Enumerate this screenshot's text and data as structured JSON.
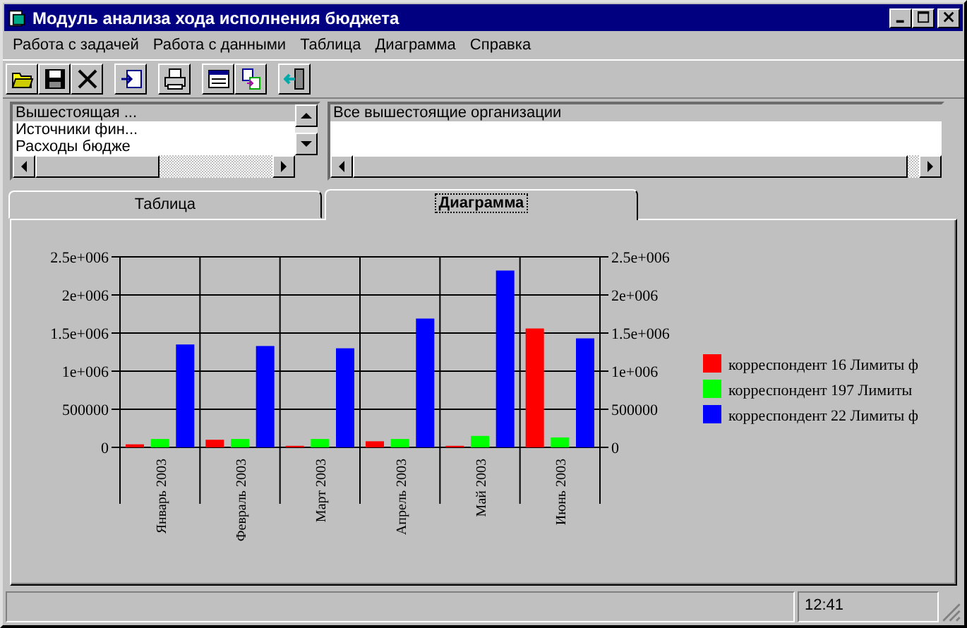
{
  "window": {
    "title": "Модуль анализа хода исполнения бюджета"
  },
  "menu": [
    "Работа с задачей",
    "Работа с данными",
    "Таблица",
    "Диаграмма",
    "Справка"
  ],
  "left_list": {
    "items": [
      {
        "label": "Вышестоящая ...",
        "selected": true
      },
      {
        "label": "Источники фин...",
        "selected": false
      },
      {
        "label": "Расходы бюдже",
        "selected": false
      }
    ]
  },
  "right_list": {
    "items": [
      {
        "label": "Все вышестоящие организации",
        "selected": true
      }
    ]
  },
  "tabs": [
    {
      "label": "Таблица",
      "selected": false
    },
    {
      "label": "Диаграмма",
      "selected": true
    }
  ],
  "chart_data": {
    "type": "bar",
    "categories": [
      "Январь 2003",
      "Февраль 2003",
      "Март 2003",
      "Апрель 2003",
      "Май 2003",
      "Июнь 2003"
    ],
    "series": [
      {
        "name": "корреспондент 16 Лимиты ф",
        "color": "#ff0000",
        "values": [
          40000,
          100000,
          20000,
          80000,
          20000,
          1560000
        ]
      },
      {
        "name": "корреспондент 197 Лимиты",
        "color": "#00ff00",
        "values": [
          110000,
          110000,
          110000,
          110000,
          150000,
          130000
        ]
      },
      {
        "name": "корреспондент 22 Лимиты ф",
        "color": "#0000ff",
        "values": [
          1350000,
          1330000,
          1300000,
          1690000,
          2320000,
          1430000
        ]
      }
    ],
    "grid": true,
    "legend": true,
    "ylim": [
      0,
      2500000
    ],
    "yticks": [
      {
        "value": 0,
        "label": "0"
      },
      {
        "value": 500000,
        "label": "500000"
      },
      {
        "value": 1000000,
        "label": "1e+006"
      },
      {
        "value": 1500000,
        "label": "1.5e+006"
      },
      {
        "value": 2000000,
        "label": "2e+006"
      },
      {
        "value": 2500000,
        "label": "2.5e+006"
      }
    ]
  },
  "status_bar": {
    "time": "12:41"
  }
}
